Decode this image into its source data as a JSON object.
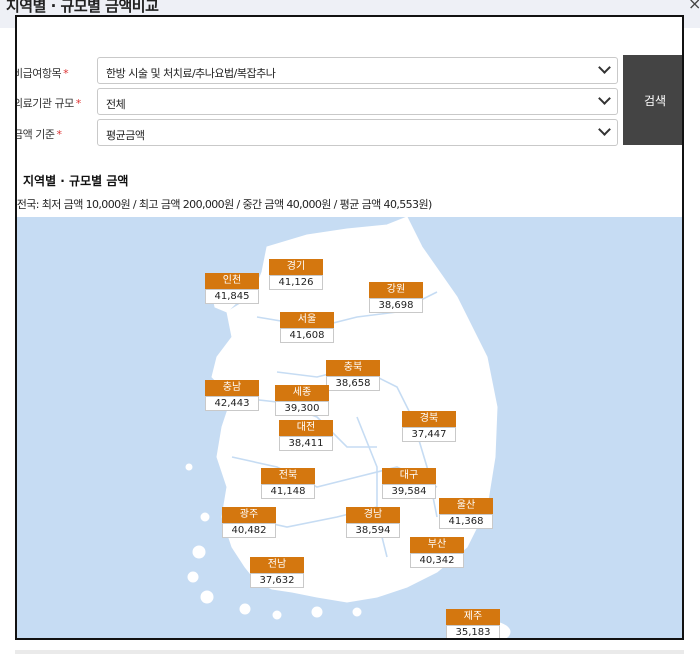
{
  "window": {
    "title": "지역별 · 규모별 금액비교",
    "close_symbol": "×"
  },
  "form": {
    "rows": [
      {
        "label": "비급여항목",
        "value": "한방 시술 및 처치료/추나요법/복잡추나"
      },
      {
        "label": "의료기관 규모",
        "value": "전체"
      },
      {
        "label": "금액 기준",
        "value": "평균금액"
      }
    ],
    "required_mark": "*",
    "search_label": "검색"
  },
  "section": {
    "heading": "지역별 · 규모별 금액",
    "summary": "(전국: 최저 금액 10,000원 / 최고 금액 200,000원 / 중간 금액 40,000원 / 평균 금액 40,553원)"
  },
  "regions": [
    {
      "name": "인천",
      "value": "41,845"
    },
    {
      "name": "경기",
      "value": "41,126"
    },
    {
      "name": "강원",
      "value": "38,698"
    },
    {
      "name": "서울",
      "value": "41,608"
    },
    {
      "name": "충북",
      "value": "38,658"
    },
    {
      "name": "충남",
      "value": "42,443"
    },
    {
      "name": "세종",
      "value": "39,300"
    },
    {
      "name": "경북",
      "value": "37,447"
    },
    {
      "name": "대전",
      "value": "38,411"
    },
    {
      "name": "전북",
      "value": "41,148"
    },
    {
      "name": "대구",
      "value": "39,584"
    },
    {
      "name": "울산",
      "value": "41,368"
    },
    {
      "name": "광주",
      "value": "40,482"
    },
    {
      "name": "경남",
      "value": "38,594"
    },
    {
      "name": "부산",
      "value": "40,342"
    },
    {
      "name": "전남",
      "value": "37,632"
    },
    {
      "name": "제주",
      "value": "35,183"
    }
  ],
  "colors": {
    "badge": "#d4770f",
    "sea": "#c6dcf3",
    "land": "#ffffff",
    "button": "#444444"
  }
}
